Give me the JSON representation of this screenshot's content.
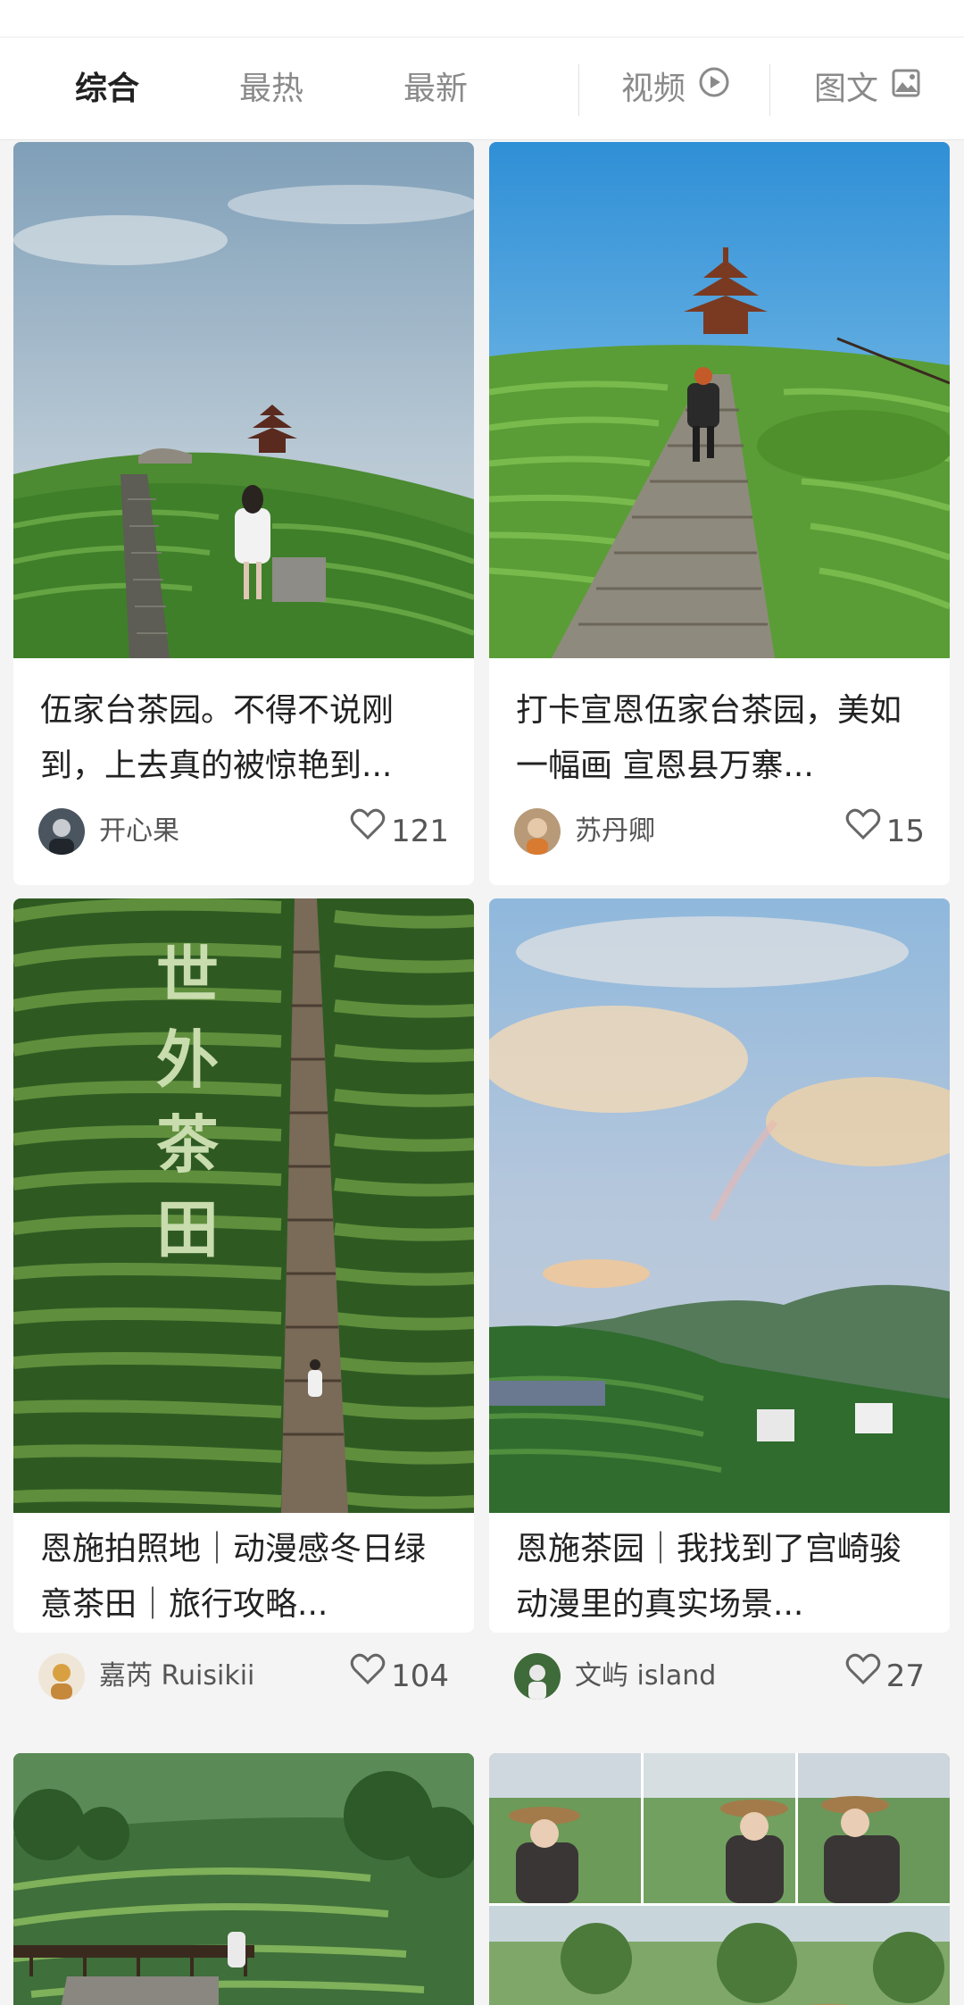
{
  "tabs": {
    "zonghe": "综合",
    "zuire": "最热",
    "zuixin": "最新",
    "video": "视频",
    "imagetext": "图文"
  },
  "colors": {
    "active_tab": "#222222",
    "inactive_tab": "#8a8a8a",
    "heart": "#666666"
  },
  "cards": [
    {
      "title": "伍家台茶园。不得不说刚到，上去真的被惊艳到...",
      "author": "开心果",
      "likes": "121",
      "icon": "heart-icon"
    },
    {
      "title": "打卡宣恩伍家台茶园，美如一幅画 宣恩县万寨...",
      "author": "苏丹卿",
      "likes": "15",
      "icon": "heart-icon"
    },
    {
      "title": "恩施拍照地｜动漫感冬日绿意茶田｜旅行攻略...",
      "author": "嘉芮 Ruisikii",
      "likes": "104",
      "icon": "heart-icon",
      "overlay_text": [
        "世",
        "外",
        "茶",
        "田"
      ]
    },
    {
      "title": "恩施茶园｜我找到了宫崎骏动漫里的真实场景...",
      "author": "文屿 island",
      "likes": "27",
      "icon": "heart-icon"
    }
  ]
}
